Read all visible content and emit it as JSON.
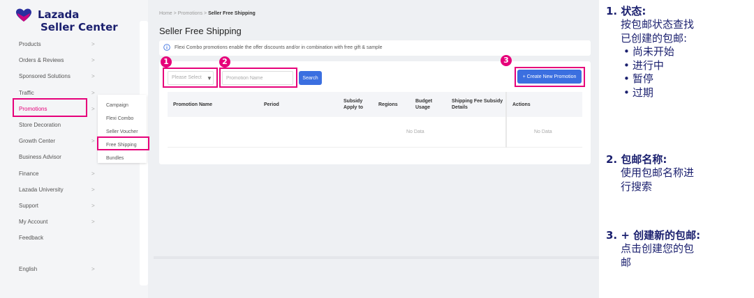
{
  "colors": {
    "highlight": "#e6007a",
    "primary_button": "#3b6fe0",
    "brand_navy": "#1a1f6e"
  },
  "logo": {
    "brand": "Lazada",
    "subtitle": "Seller Center",
    "icon": "lazada-heart-icon"
  },
  "sidebar": {
    "items": [
      {
        "label": "Products",
        "chevron": true
      },
      {
        "label": "Orders & Reviews",
        "chevron": true
      },
      {
        "label": "Sponsored Solutions",
        "chevron": true
      },
      {
        "label": "Traffic",
        "chevron": true
      },
      {
        "label": "Promotions",
        "chevron": true,
        "active": true
      },
      {
        "label": "Store Decoration",
        "chevron": false
      },
      {
        "label": "Growth Center",
        "chevron": true
      },
      {
        "label": "Business Advisor",
        "chevron": false
      },
      {
        "label": "Finance",
        "chevron": true
      },
      {
        "label": "Lazada University",
        "chevron": true
      },
      {
        "label": "Support",
        "chevron": true
      },
      {
        "label": "My Account",
        "chevron": true
      },
      {
        "label": "Feedback",
        "chevron": false
      },
      {
        "label": "English",
        "chevron": true
      }
    ],
    "chevron_glyph": ">",
    "submenu": [
      "Campaign",
      "Flexi Combo",
      "Seller Voucher",
      "Free Shipping",
      "Bundles"
    ]
  },
  "breadcrumb": {
    "home": "Home",
    "sep": ">",
    "parent": "Promotions",
    "current": "Seller Free Shipping"
  },
  "page": {
    "title": "Seller Free Shipping",
    "info": "Flexi Combo promotions enable the offer discounts and/or in combination with free gift & sample"
  },
  "filters": {
    "status_placeholder": "Please Select",
    "name_placeholder": "Promotion Name",
    "search_label": "Search",
    "create_label": "+ Create New Promotion"
  },
  "markers": [
    "1",
    "2",
    "3"
  ],
  "table": {
    "headers": {
      "name": "Promotion Name",
      "period": "Period",
      "subsidy_1": "Subsidy",
      "subsidy_2": "Apply to",
      "regions": "Regions",
      "budget_1": "Budget",
      "budget_2": "Usage",
      "fee_1": "Shipping Fee Subsidy",
      "fee_2": "Details",
      "actions": "Actions"
    },
    "empty_text": "No Data",
    "actions_empty_text": "No Data"
  },
  "notes": [
    {
      "head": "1. 状态:",
      "body": [
        "按包邮状态查找",
        "已创建的包邮:"
      ],
      "bullets": [
        "尚未开始",
        "进行中",
        "暂停",
        "过期"
      ]
    },
    {
      "head": "2. 包邮名称:",
      "body": [
        "使用包邮名称进",
        "行搜索"
      ]
    },
    {
      "head": "3. + 创建新的包邮:",
      "body": [
        "点击创建您的包",
        "邮"
      ]
    }
  ]
}
